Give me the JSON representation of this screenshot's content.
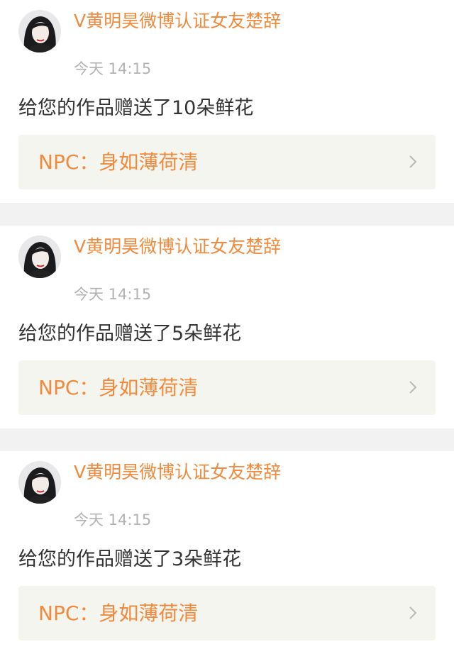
{
  "colors": {
    "accent": "#f08a3c",
    "time": "#b3b3b3",
    "text": "#333333",
    "link_bg": "#f5f5ef"
  },
  "notifications": [
    {
      "user_name": "V黄明昊微博认证女友楚辞",
      "time": "今天 14:15",
      "message": "给您的作品赠送了10朵鲜花",
      "link_label": "NPC：身如薄荷清",
      "avatar_icon": "user-avatar-icon",
      "chevron_icon": "chevron-right-icon"
    },
    {
      "user_name": "V黄明昊微博认证女友楚辞",
      "time": "今天 14:15",
      "message": "给您的作品赠送了5朵鲜花",
      "link_label": "NPC：身如薄荷清",
      "avatar_icon": "user-avatar-icon",
      "chevron_icon": "chevron-right-icon"
    },
    {
      "user_name": "V黄明昊微博认证女友楚辞",
      "time": "今天 14:15",
      "message": "给您的作品赠送了3朵鲜花",
      "link_label": "NPC：身如薄荷清",
      "avatar_icon": "user-avatar-icon",
      "chevron_icon": "chevron-right-icon"
    }
  ]
}
